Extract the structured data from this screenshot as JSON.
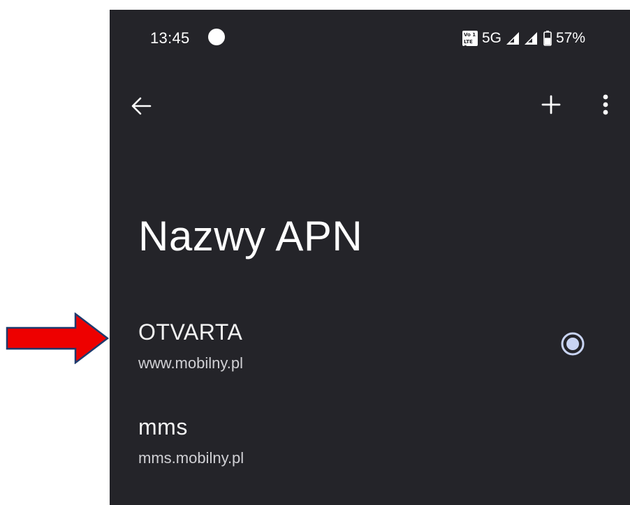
{
  "status_bar": {
    "time": "13:45",
    "volte_top": "Vo 1",
    "volte_bottom": "LTE 2",
    "network_type": "5G",
    "battery_percent": "57%",
    "battery_level": 0.57,
    "icons": [
      "notification-dot-icon",
      "volte-icon",
      "signal-icon",
      "signal-icon",
      "battery-icon"
    ]
  },
  "toolbar": {
    "icons": [
      "back-arrow-icon",
      "plus-icon",
      "more-vert-icon"
    ]
  },
  "page": {
    "title": "Nazwy APN"
  },
  "apn_list": [
    {
      "name": "OTVARTA",
      "url": "www.mobilny.pl",
      "selected": true
    },
    {
      "name": "mms",
      "url": "mms.mobilny.pl",
      "selected": false
    }
  ],
  "colors": {
    "background": "#242429",
    "text_primary": "#ffffff",
    "text_secondary": "#d0d0d4",
    "radio_accent": "#c9d4f3",
    "annotation_arrow_fill": "#ee0000",
    "annotation_arrow_stroke": "#1f3b6e"
  }
}
